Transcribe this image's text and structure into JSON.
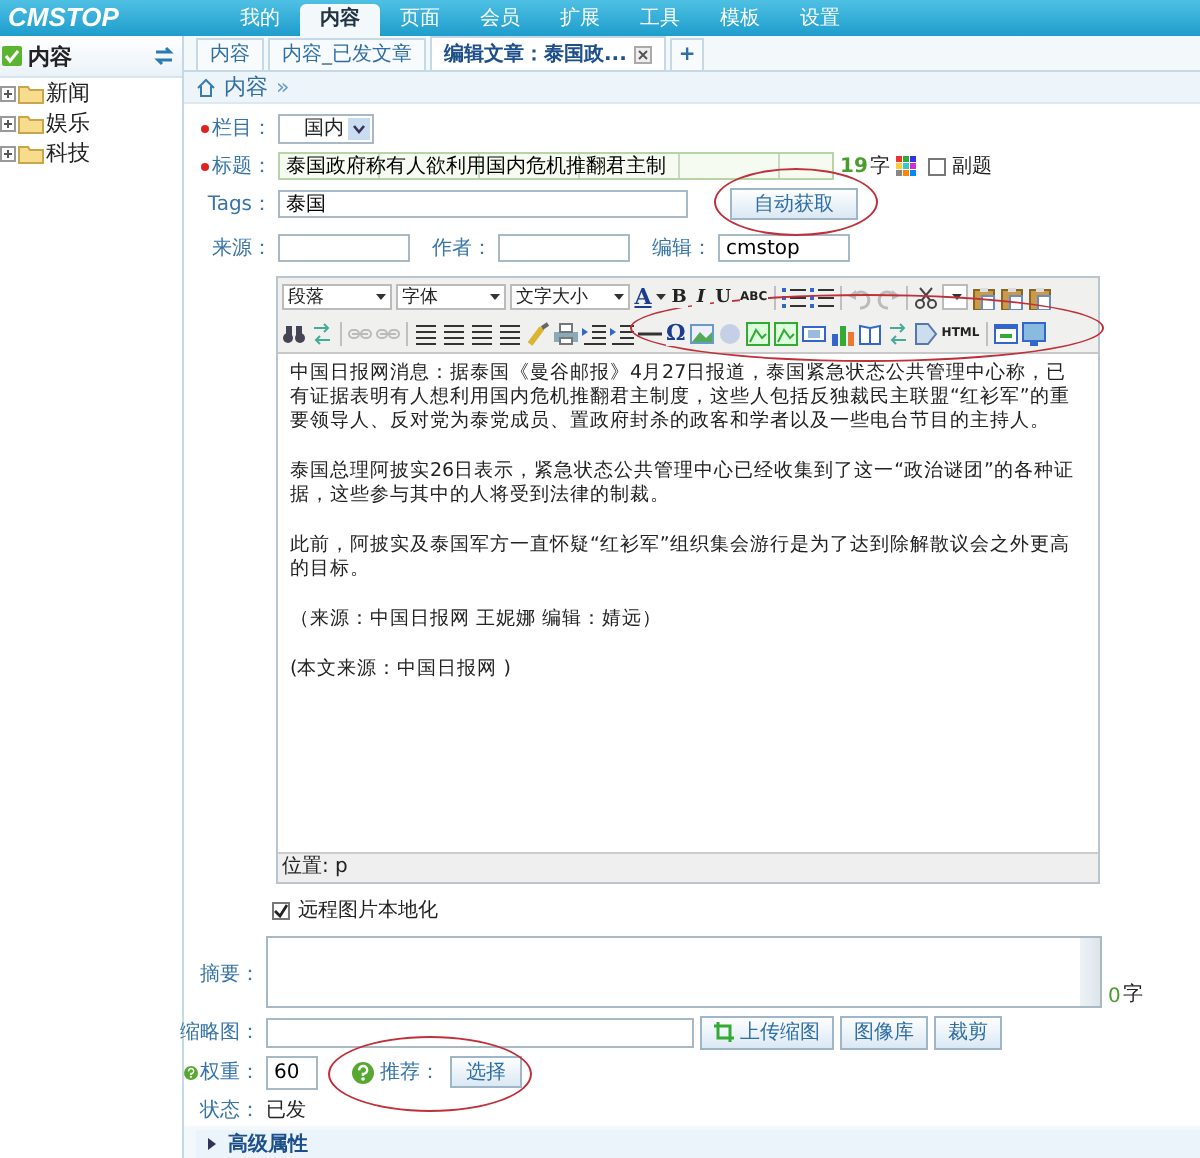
{
  "app": {
    "logo": "CMSTOP",
    "nav": [
      {
        "label": "我的",
        "selected": false
      },
      {
        "label": "内容",
        "selected": true
      },
      {
        "label": "页面",
        "selected": false
      },
      {
        "label": "会员",
        "selected": false
      },
      {
        "label": "扩展",
        "selected": false
      },
      {
        "label": "工具",
        "selected": false
      },
      {
        "label": "模板",
        "selected": false
      },
      {
        "label": "设置",
        "selected": false
      }
    ]
  },
  "sidebar": {
    "title": "内容",
    "items": [
      {
        "label": "新闻",
        "expanded": false
      },
      {
        "label": "娱乐",
        "expanded": false
      },
      {
        "label": "科技",
        "expanded": false
      }
    ]
  },
  "tabs": [
    {
      "label": "内容",
      "selected": false,
      "closable": false
    },
    {
      "label": "内容_已发文章",
      "selected": false,
      "closable": false
    },
    {
      "label": "编辑文章：泰国政...",
      "selected": true,
      "closable": true
    }
  ],
  "add_tab": "+",
  "breadcrumb": [
    "内容",
    "»"
  ],
  "form": {
    "column": {
      "label": "栏目：",
      "required": true,
      "value": "国内"
    },
    "title": {
      "label": "标题：",
      "required": true,
      "value": "泰国政府称有人欲利用国内危机推翻君主制",
      "count": "19",
      "count_unit": "字",
      "subtitle": {
        "label": "副题",
        "checked": false
      }
    },
    "tags": {
      "label": "Tags：",
      "value": "泰国",
      "button": "自动获取",
      "circled": true
    },
    "source": {
      "label": "来源："
    },
    "author": {
      "label": "作者："
    },
    "editor_name": {
      "label": "编辑：",
      "value": "cmstop"
    },
    "editor": {
      "dropdowns": [
        "段落",
        "字体",
        "文字大小"
      ],
      "glyphs": [
        "A",
        "B",
        "I",
        "U",
        "ABC",
        "Ω",
        "HTML"
      ],
      "circled": true,
      "paragraphs": [
        "中国日报网消息：据泰国《曼谷邮报》4月27日报道，泰国紧急状态公共管理中心称，已有证据表明有人想利用国内危机推翻君主制度，这些人包括反独裁民主联盟“红衫军”的重要领导人、反对党为泰党成员、置政府封杀的政客和学者以及一些电台节目的主持人。",
        "泰国总理阿披实26日表示，紧急状态公共管理中心已经收集到了这一“政治谜团”的各种证据，这些参与其中的人将受到法律的制裁。",
        "此前，阿披实及泰国军方一直怀疑“红衫军”组织集会游行是为了达到除解散议会之外更高的目标。",
        "（来源：中国日报网 王妮娜 编辑：婧远）",
        "(本文来源：中国日报网 )"
      ],
      "status": "位置: p"
    },
    "localize_images": {
      "label": "远程图片本地化",
      "checked": true
    },
    "summary": {
      "label": "摘要：",
      "count": "0",
      "count_unit": "字"
    },
    "thumbnail": {
      "label": "缩略图：",
      "buttons": [
        "上传缩图",
        "图像库",
        "裁剪"
      ]
    },
    "weight": {
      "label": "权重：",
      "value": "60"
    },
    "recommend": {
      "label": "推荐：",
      "button": "选择",
      "circled": true
    },
    "state": {
      "label": "状态：",
      "value": "已发"
    },
    "advanced": {
      "label": "高级属性",
      "expanded": false
    }
  }
}
